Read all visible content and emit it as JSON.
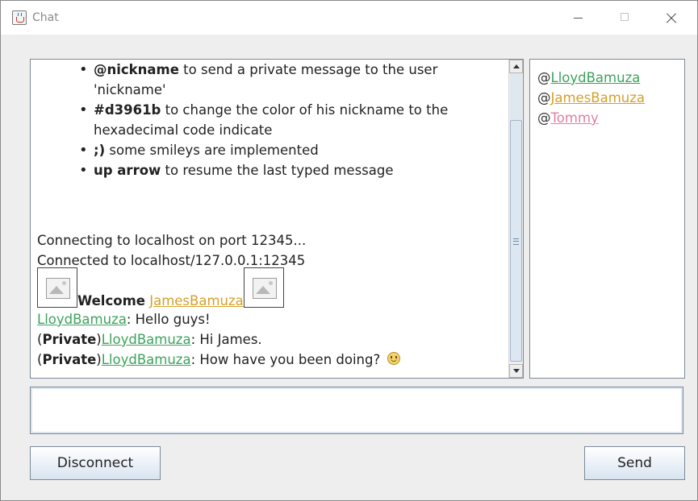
{
  "window": {
    "title": "Chat"
  },
  "chat": {
    "help": [
      {
        "cmd": "@nickname",
        "text": " to send a private message to the user"
      },
      {
        "cont": "'nickname'"
      },
      {
        "cmd": "#d3961b",
        "text": " to change the color of his nickname to the"
      },
      {
        "cont": "hexadecimal code indicate"
      },
      {
        "cmd": ";)",
        "text": " some smileys are implemented"
      },
      {
        "cmd": "up arrow",
        "text": " to resume the last typed message"
      }
    ],
    "connecting": "Connecting to localhost on port 12345...",
    "connected": "Connected to localhost/127.0.0.1:12345",
    "welcome": {
      "label": "Welcome",
      "name": "JamesBamuza"
    },
    "messages": [
      {
        "sender": "LloydBamuza",
        "text": ": Hello guys!"
      },
      {
        "open": "(",
        "tag": "Private",
        "close": ")",
        "sender": "LloydBamuza",
        "text": ": Hi James."
      },
      {
        "open": "(",
        "tag": "Private",
        "close": ")",
        "sender": "LloydBamuza",
        "text": ": How have you been doing? "
      }
    ]
  },
  "users": {
    "prefix": "@",
    "list": [
      {
        "name": "LloydBamuza",
        "color": "#3da35d"
      },
      {
        "name": "JamesBamuza",
        "color": "#d5a02a"
      },
      {
        "name": "Tommy",
        "color": "#e07fa0"
      }
    ]
  },
  "input": {
    "value": ""
  },
  "buttons": {
    "disconnect": "Disconnect",
    "send": "Send"
  }
}
